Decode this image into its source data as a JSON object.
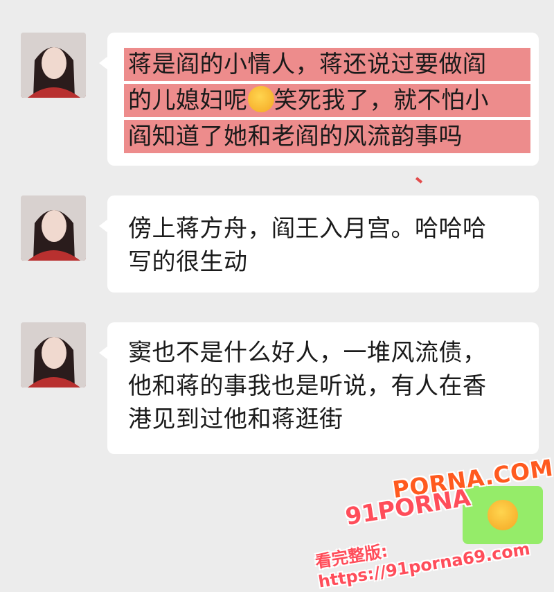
{
  "messages": [
    {
      "lines": [
        "蒋是阎的小情人，蒋还说过要做阎",
        "的儿媳妇呢",
        "笑死我了，就不怕小",
        "阎知道了她和老阎的风流韵事吗"
      ],
      "highlighted": true,
      "emoji": "laughing-crying-emoji"
    },
    {
      "lines": [
        "傍上蒋方舟，阎王入月宫。哈哈哈",
        "写的很生动"
      ],
      "highlighted": false
    },
    {
      "lines": [
        "窦也不是什么好人，一堆风流债，",
        "他和蒋的事我也是听说，有人在香",
        "港见到过他和蒋逛街"
      ],
      "highlighted": false
    }
  ],
  "outgoing": {
    "emoji": "exploding-head-emoji",
    "bubble_color": "#95ec69"
  },
  "watermark": {
    "site": "PORNA.COM",
    "logo": "91PORNA",
    "url": "看完整版: https://91porna69.com"
  },
  "colors": {
    "highlight": "#e97373",
    "background": "#ececec",
    "bubble": "#ffffff"
  }
}
